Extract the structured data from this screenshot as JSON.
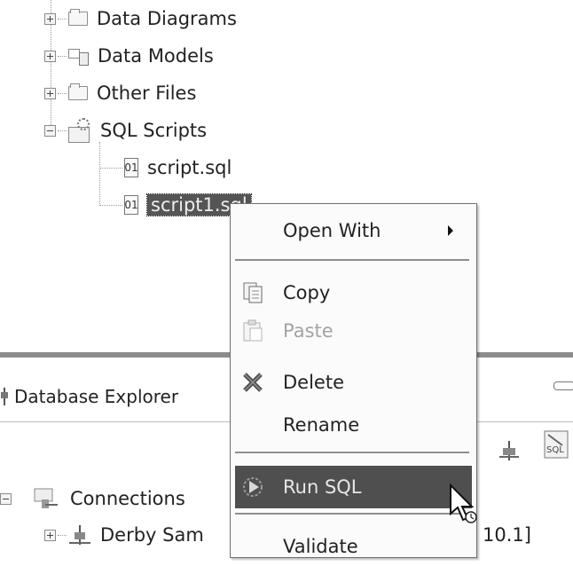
{
  "project_tree": {
    "items": [
      {
        "label": "Data Diagrams",
        "icon": "folder-icon",
        "expander": "plus"
      },
      {
        "label": "Data Models",
        "icon": "data-model-icon",
        "expander": "plus"
      },
      {
        "label": "Other Files",
        "icon": "folder-icon",
        "expander": "plus"
      },
      {
        "label": "SQL Scripts",
        "icon": "sql-scripts-folder-icon",
        "expander": "minus"
      }
    ],
    "children": [
      {
        "label": "script.sql",
        "icon": "sql-file-icon"
      },
      {
        "label": "script1.sql",
        "icon": "sql-file-icon",
        "selected": true
      }
    ]
  },
  "database_explorer": {
    "tab_label": "Database Explorer",
    "tab_icon": "plug-icon",
    "connections_label": "Connections",
    "derby_label": "Derby Sam",
    "derby_suffix": "10.1]"
  },
  "context_menu": {
    "items": [
      {
        "label": "Open With",
        "submenu": true
      },
      {
        "label": "Copy",
        "icon": "copy-icon"
      },
      {
        "label": "Paste",
        "icon": "paste-icon",
        "disabled": true
      },
      {
        "label": "Delete",
        "icon": "delete-icon"
      },
      {
        "label": "Rename"
      },
      {
        "label": "Run SQL",
        "icon": "run-sql-icon",
        "hovered": true
      },
      {
        "label": "Validate"
      }
    ]
  },
  "colors": {
    "menu_hover_bg": "#4f4f4f",
    "selection_bg": "#555555",
    "panel_separator": "#8c8c8c",
    "disabled_text": "#a3a3a3"
  }
}
